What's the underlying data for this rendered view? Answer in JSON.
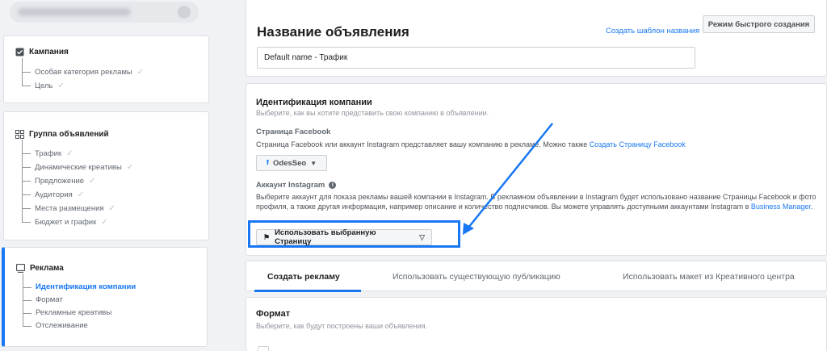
{
  "sidebar": {
    "campaign": {
      "title": "Кампания",
      "items": [
        {
          "label": "Особая категория рекламы"
        },
        {
          "label": "Цель"
        }
      ]
    },
    "adset": {
      "title": "Группа объявлений",
      "items": [
        {
          "label": "Трафик"
        },
        {
          "label": "Динамические креативы"
        },
        {
          "label": "Предложение"
        },
        {
          "label": "Аудитория"
        },
        {
          "label": "Места размещения"
        },
        {
          "label": "Бюджет и график"
        }
      ]
    },
    "ad": {
      "title": "Реклама",
      "items": [
        {
          "label": "Идентификация компании"
        },
        {
          "label": "Формат"
        },
        {
          "label": "Рекламные креативы"
        },
        {
          "label": "Отслеживание"
        }
      ]
    }
  },
  "ad_name": {
    "title": "Название объявления",
    "template_link": "Создать шаблон названия",
    "quick_mode_button": "Режим быстрого создания",
    "input_value": "Default name - Трафик"
  },
  "identity": {
    "title": "Идентификация компании",
    "subtitle": "Выберите, как вы хотите представить свою компанию в объявлении.",
    "facebook_label": "Страница Facebook",
    "facebook_desc": "Страница Facebook или аккаунт Instagram представляет вашу компанию в рекламе. Можно также ",
    "facebook_link": "Создать Страницу Facebook",
    "page_button": "OdesSeo",
    "instagram_label": "Аккаунт Instagram",
    "instagram_desc": "Выберите аккаунт для показа рекламы вашей компании в Instagram. В рекламном объявлении в Instagram будет использовано название Страницы Facebook и фото профиля, а также другая информация, например описание и количество подписчиков. Вы можете управлять доступными аккаунтами Instagram в ",
    "instagram_link": "Business Manager",
    "instagram_desc_end": ".",
    "use_page_button": "Использовать выбранную Страницу"
  },
  "tabs": [
    {
      "label": "Создать рекламу"
    },
    {
      "label": "Использовать существующую публикацию"
    },
    {
      "label": "Использовать макет из Креативного центра"
    }
  ],
  "format": {
    "title": "Формат",
    "subtitle": "Выберите, как будут построены ваши объявления."
  },
  "colors": {
    "accent": "#1877f2",
    "background": "#f0f2f5"
  },
  "icons": [
    "checkbox-icon",
    "grid-icon",
    "ad-icon",
    "check-icon",
    "upload-icon",
    "caret-down-icon",
    "flag-icon",
    "info-icon"
  ]
}
